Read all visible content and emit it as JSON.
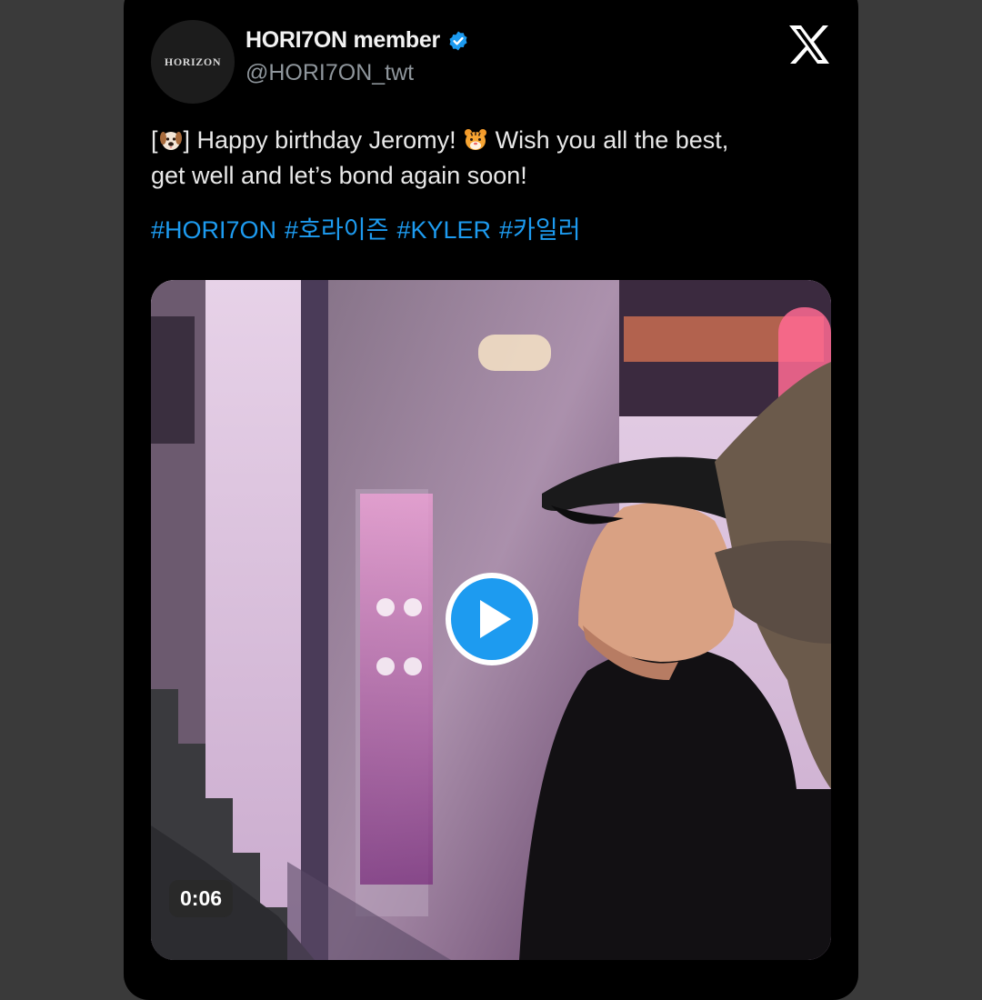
{
  "tweet": {
    "avatar_text": "HORIZON",
    "display_name": "HORI7ON member",
    "handle": "@HORI7ON_twt",
    "text_line1_prefix": "[",
    "text_line1_mid": "] Happy birthday Jeromy! ",
    "text_line1_suffix": " Wish you all the best,",
    "text_line2": "get well and let’s bond again soon!",
    "hashtags": [
      "#HORI7ON",
      "#호라이즌",
      "#KYLER",
      "#카일러"
    ],
    "icons": {
      "dog": "dog-face-emoji",
      "tiger": "tiger-face-emoji",
      "verified": "verified-badge-icon",
      "platform": "x-logo-icon"
    },
    "accent_color": "#1d9bf0"
  },
  "media": {
    "type": "video",
    "duration": "0:06",
    "play_icon": "play-icon"
  }
}
